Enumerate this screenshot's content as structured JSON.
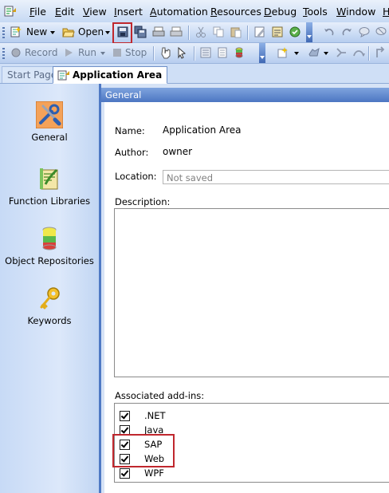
{
  "menu": {
    "items": [
      "File",
      "Edit",
      "View",
      "Insert",
      "Automation",
      "Resources",
      "Debug",
      "Tools",
      "Window",
      "H"
    ]
  },
  "toolbar1": {
    "new_label": "New",
    "open_label": "Open",
    "icons": [
      "new-icon",
      "open-icon",
      "save-icon",
      "save-all-icon",
      "print-preview-icon",
      "print-icon",
      "cut-icon",
      "copy-icon",
      "paste-icon",
      "edit-icon",
      "properties-icon",
      "check-icon",
      "undo-icon",
      "redo-icon",
      "comment-icon",
      "uncomment-icon"
    ]
  },
  "toolbar2": {
    "record_label": "Record",
    "run_label": "Run",
    "stop_label": "Stop"
  },
  "tabs": {
    "start_page": "Start Page",
    "application_area": "Application Area"
  },
  "sidebar": {
    "items": [
      {
        "label": "General",
        "icon": "tools-icon"
      },
      {
        "label": "Function Libraries",
        "icon": "function-library-icon"
      },
      {
        "label": "Object Repositories",
        "icon": "object-repository-icon"
      },
      {
        "label": "Keywords",
        "icon": "key-icon"
      }
    ]
  },
  "panel": {
    "header": "General",
    "name_label": "Name:",
    "name_value": "Application Area",
    "author_label": "Author:",
    "author_value": "owner",
    "location_label": "Location:",
    "location_value": "Not saved",
    "description_label": "Description:",
    "description_value": "",
    "addins_label": "Associated add-ins:",
    "addins": [
      {
        "label": ".NET",
        "checked": true
      },
      {
        "label": "Java",
        "checked": true
      },
      {
        "label": "SAP",
        "checked": true
      },
      {
        "label": "Web",
        "checked": true
      },
      {
        "label": "WPF",
        "checked": true
      }
    ]
  },
  "colors": {
    "highlight": "#c0272d",
    "panel_header": "#4c76c2",
    "sidebar_border": "#4f79c4"
  }
}
